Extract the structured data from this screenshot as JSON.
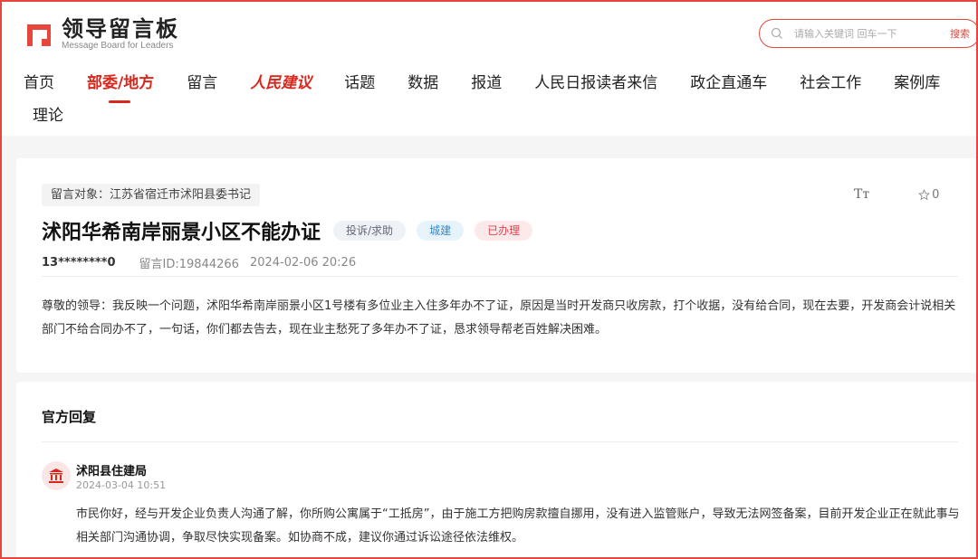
{
  "header": {
    "logo_title": "领导留言板",
    "logo_sub": "Message Board for Leaders",
    "search_placeholder": "请输入关键词 回车一下",
    "search_button": "搜索"
  },
  "nav": {
    "items": [
      "首页",
      "部委/地方",
      "留言",
      "人民建议",
      "话题",
      "数据",
      "报道",
      "人民日报读者来信",
      "政企直通车",
      "社会工作",
      "案例库"
    ],
    "row2": "理论",
    "active_index": 1
  },
  "message": {
    "target": "留言对象：江苏省宿迁市沭阳县委书记",
    "font_tool": "Tт",
    "favorite_count": "0",
    "title": "沭阳华希南岸丽景小区不能办证",
    "badges": [
      "投诉/求助",
      "城建",
      "已办理"
    ],
    "user": "13********0",
    "id": "留言ID:19844266",
    "time": "2024-02-06 20:26",
    "content": "尊敬的领导：我反映一个问题，沭阳华希南岸丽景小区1号楼有多位业主入住多年办不了证，原因是当时开发商只收房款，打个收据，没有给合同，现在去要，开发商会计说相关部门不给合同办不了，一句话，你们都去告去，现在业主愁死了多年办不了证，恳求领导帮老百姓解决困难。"
  },
  "reply": {
    "section_title": "官方回复",
    "dept": "沭阳县住建局",
    "time": "2024-03-04 10:51",
    "content": "市民你好，经与开发企业负责人沟通了解，你所购公寓属于“工抵房”，由于施工方把购房款擅自挪用，没有进入监管账户，导致无法网签备案，目前开发企业正在就此事与相关部门沟通协调，争取尽快实现备案。如协商不成，建议你通过诉讼途径依法维权。"
  },
  "colors": {
    "brand_red": "#d8271c",
    "frame_red": "#e8453c"
  }
}
